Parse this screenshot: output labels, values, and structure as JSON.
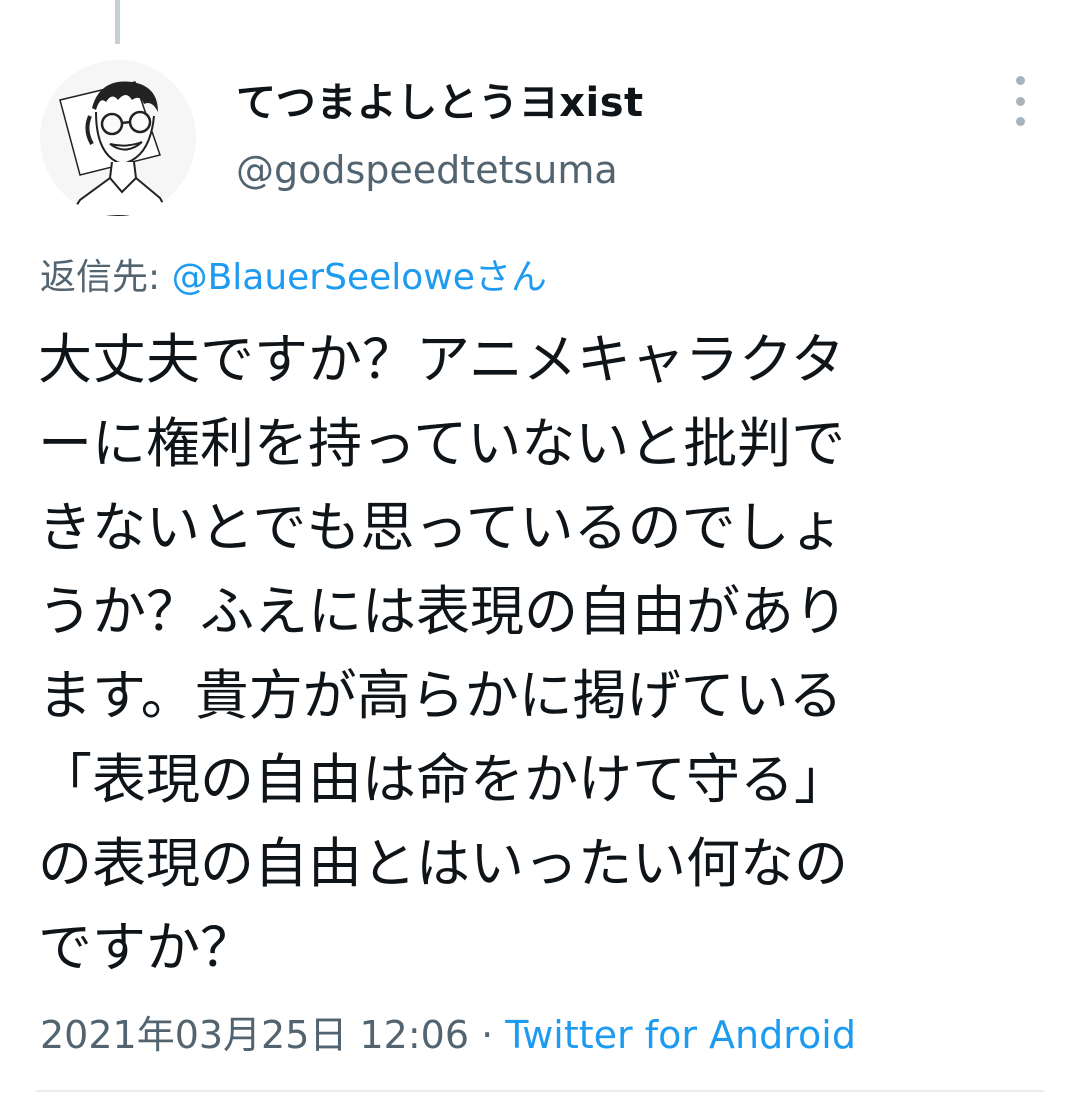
{
  "tweet": {
    "display_name": "てつまよしとうヨxist",
    "handle": "@godspeedtetsuma",
    "reply_label": "返信先: ",
    "reply_mention": "@BlauerSeeloweさん",
    "body_lines": [
      "大丈夫ですか？アニメキャラクタ",
      "ーに権利を持っていないと批判で",
      "きないとでも思っているのでしょ",
      "うか？ふえには表現の自由があり",
      "ます。貴方が高らかに掲げている",
      "「表現の自由は命をかけて守る」",
      "の表現の自由とはいったい何なの",
      "ですか？"
    ],
    "timestamp": "2021年03月25日 12:06",
    "separator": " · ",
    "source": "Twitter for Android"
  },
  "icons": {
    "more": "more-vertical-icon",
    "avatar": "user-avatar-illustration"
  },
  "colors": {
    "link": "#1d9bf0",
    "secondary_text": "#536471",
    "primary_text": "#0f1419",
    "thread_line": "#c4cfd6"
  }
}
